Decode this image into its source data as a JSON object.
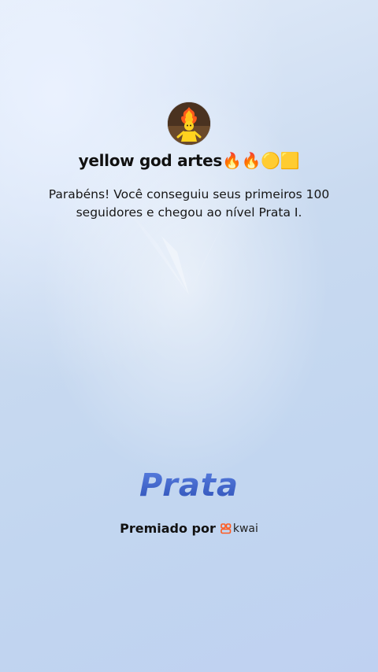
{
  "profile": {
    "username": "yellow god artes🔥🔥🟡🟨"
  },
  "message": {
    "text": "Parabéns! Você conseguiu seus primeiros 100 seguidores e chegou ao nível Prata I."
  },
  "level": {
    "name": "Prata"
  },
  "award": {
    "label": "Premiado por",
    "brand": "kwai",
    "brand_color": "#ff5a1f"
  },
  "colors": {
    "level_text": "#3f63c8",
    "background": "#c9daf0"
  },
  "icons": {
    "avatar": "fire-figure-avatar",
    "brand": "kwai-logo-icon"
  }
}
